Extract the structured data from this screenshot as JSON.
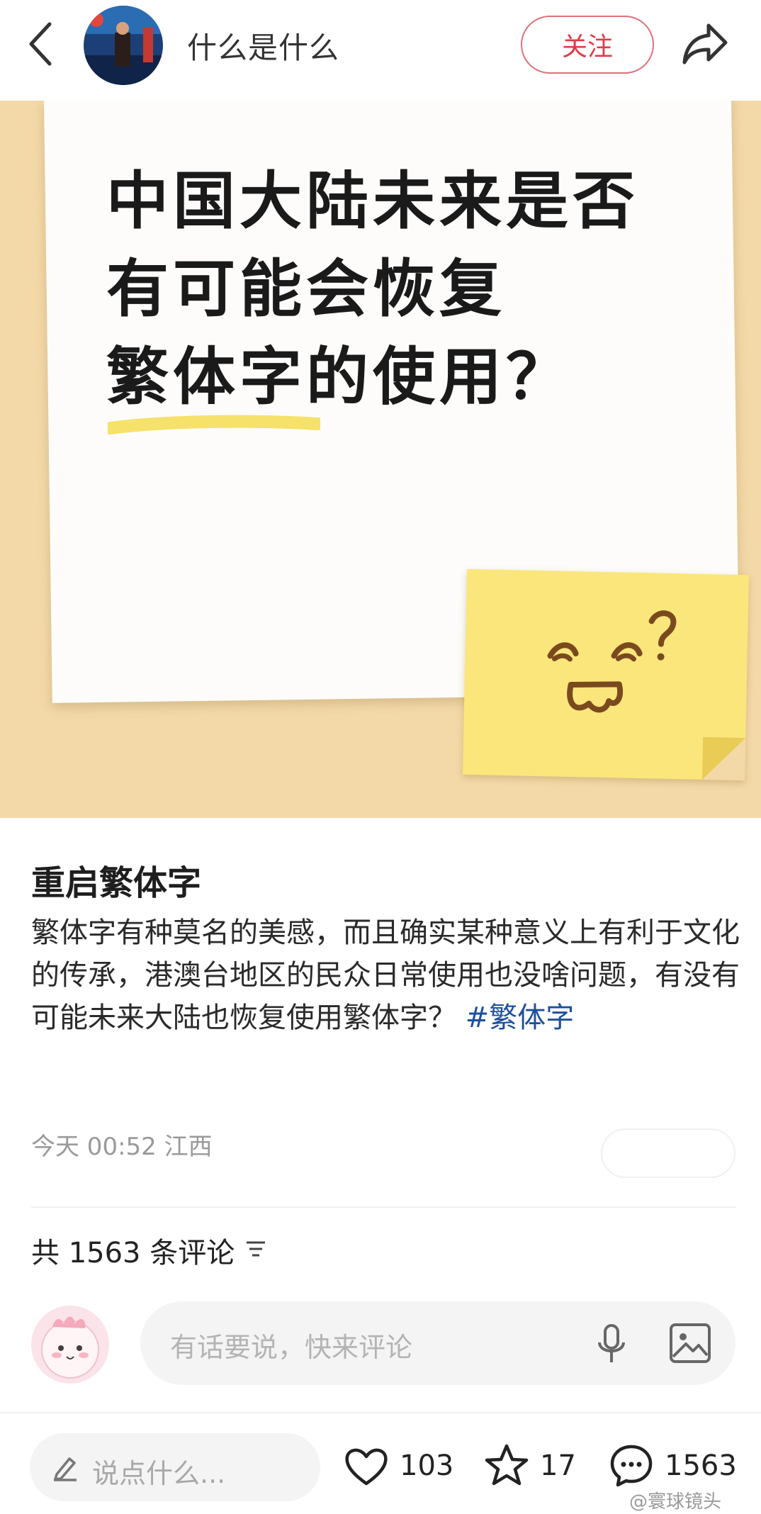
{
  "header": {
    "author": "什么是什么",
    "follow_label": "关注"
  },
  "hero": {
    "question_lines": [
      "中国大陆未来是否",
      "有可能会恢复",
      "繁体字的使用？"
    ]
  },
  "post": {
    "title": "重启繁体字",
    "body": "繁体字有种莫名的美感，而且确实某种意义上有利于文化的传承，港澳台地区的民众日常使用也没啥问题，有没有可能未来大陆也恢复使用繁体字？",
    "tag": "#繁体字",
    "time": "今天 00:52",
    "location": "江西"
  },
  "comments": {
    "count_label": "共 1563 条评论",
    "input_placeholder": "有话要说，快来评论"
  },
  "bottom_bar": {
    "say_placeholder": "说点什么...",
    "likes": "103",
    "favorites": "17",
    "comments": "1563"
  },
  "watermark": "@寰球镜头",
  "colors": {
    "accent_red": "#e23a4a",
    "tag_blue": "#1d4f9c",
    "hero_bg": "#f4d9a8",
    "sticky_note": "#fbe67c"
  }
}
